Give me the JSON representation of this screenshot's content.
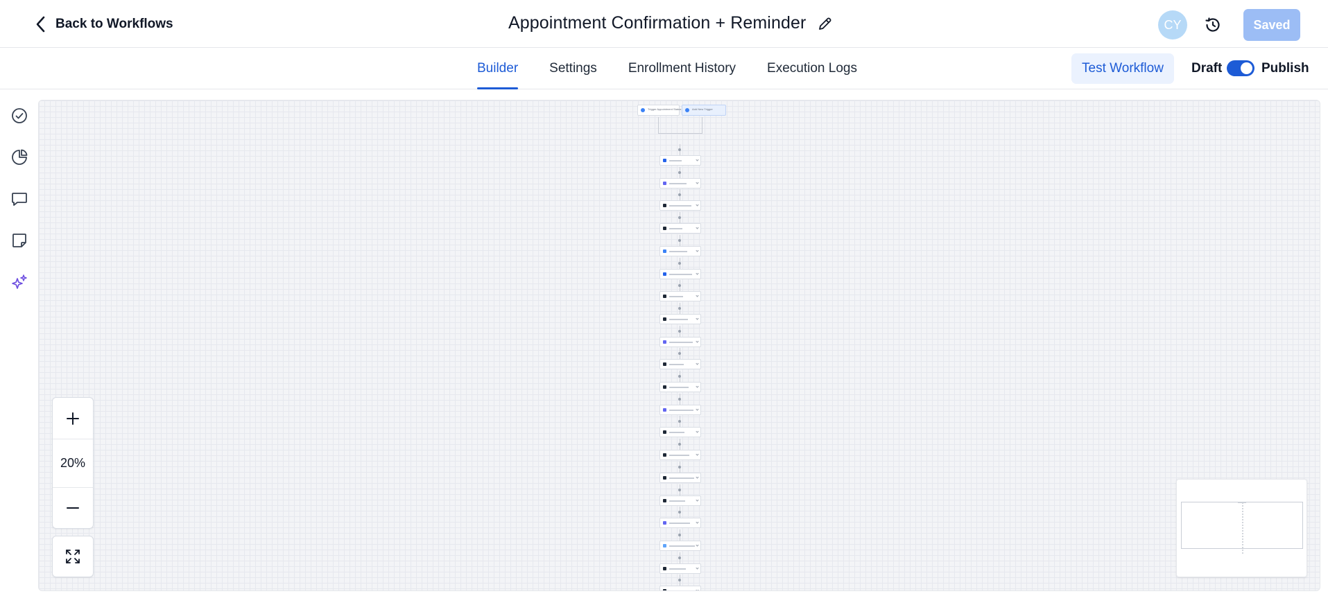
{
  "header": {
    "back_label": "Back to Workflows",
    "title": "Appointment Confirmation + Reminder",
    "avatar_initials": "CY",
    "saved_label": "Saved"
  },
  "tabs": [
    {
      "label": "Builder",
      "active": true
    },
    {
      "label": "Settings",
      "active": false
    },
    {
      "label": "Enrollment History",
      "active": false
    },
    {
      "label": "Execution Logs",
      "active": false
    }
  ],
  "actions": {
    "test_workflow_label": "Test Workflow",
    "draft_label": "Draft",
    "publish_label": "Publish",
    "publish_toggle_on": true
  },
  "sidebar_icons": [
    "check-circle-icon",
    "pie-chart-icon",
    "comment-icon",
    "sticky-note-icon",
    "sparkles-icon"
  ],
  "canvas": {
    "triggers": [
      {
        "label": "Trigger Appointment Status",
        "icon": "calendar-icon"
      },
      {
        "label": "Add New Trigger",
        "icon": "plus-icon"
      }
    ],
    "node_count": 20
  },
  "zoom": {
    "level": "20%"
  },
  "colors": {
    "primary": "#1d5bd6",
    "saved_button": "#9cbdf5",
    "avatar": "#b6d9f7",
    "sparkles": "#6d4ee0",
    "canvas_bg": "#f3f4f7"
  }
}
